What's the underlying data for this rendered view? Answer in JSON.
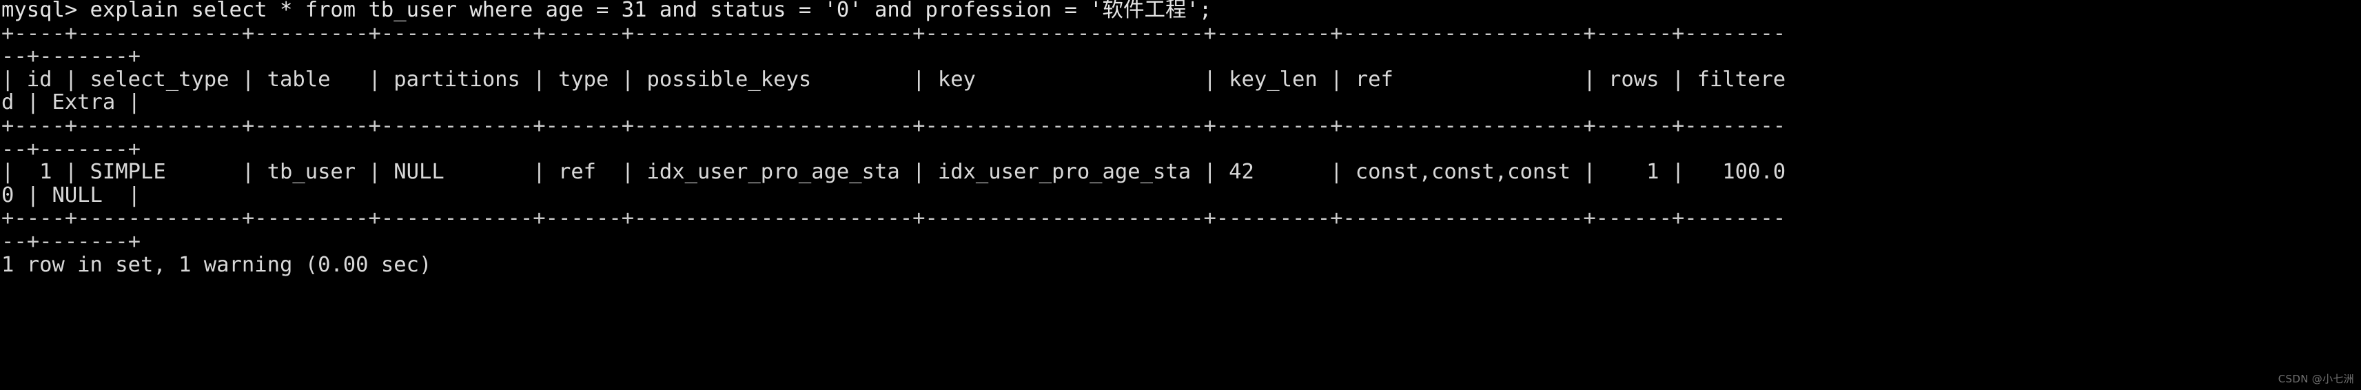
{
  "terminal": {
    "background_color": "#000000",
    "text_color": "#d8d8d8",
    "lines": [
      "mysql> explain select * from tb_user where age = 31 and status = '0' and profession = '软件工程';",
      "+----+-------------+---------+------------+------+----------------------+----------------------+---------+-------------------+------+--------",
      "--+-------+",
      "| id | select_type | table   | partitions | type | possible_keys        | key                  | key_len | ref               | rows | filtere",
      "d | Extra |",
      "+----+-------------+---------+------------+------+----------------------+----------------------+---------+-------------------+------+--------",
      "--+-------+",
      "|  1 | SIMPLE      | tb_user | NULL       | ref  | idx_user_pro_age_sta | idx_user_pro_age_sta | 42      | const,const,const |    1 |   100.0",
      "0 | NULL  |",
      "+----+-------------+---------+------------+------+----------------------+----------------------+---------+-------------------+------+--------",
      "--+-------+",
      "1 row in set, 1 warning (0.00 sec)"
    ],
    "prompt": "mysql>",
    "query": "explain select * from tb_user where age = 31 and status = '0' and profession = '软件工程';",
    "explain_table": {
      "columns": [
        "id",
        "select_type",
        "table",
        "partitions",
        "type",
        "possible_keys",
        "key",
        "key_len",
        "ref",
        "rows",
        "filtered",
        "Extra"
      ],
      "rows": [
        {
          "id": "1",
          "select_type": "SIMPLE",
          "table": "tb_user",
          "partitions": "NULL",
          "type": "ref",
          "possible_keys": "idx_user_pro_age_sta",
          "key": "idx_user_pro_age_sta",
          "key_len": "42",
          "ref": "const,const,const",
          "rows": "1",
          "filtered": "100.00",
          "Extra": "NULL"
        }
      ]
    },
    "status_line": "1 row in set, 1 warning (0.00 sec)"
  },
  "watermark": {
    "text": "CSDN @小七洲"
  }
}
